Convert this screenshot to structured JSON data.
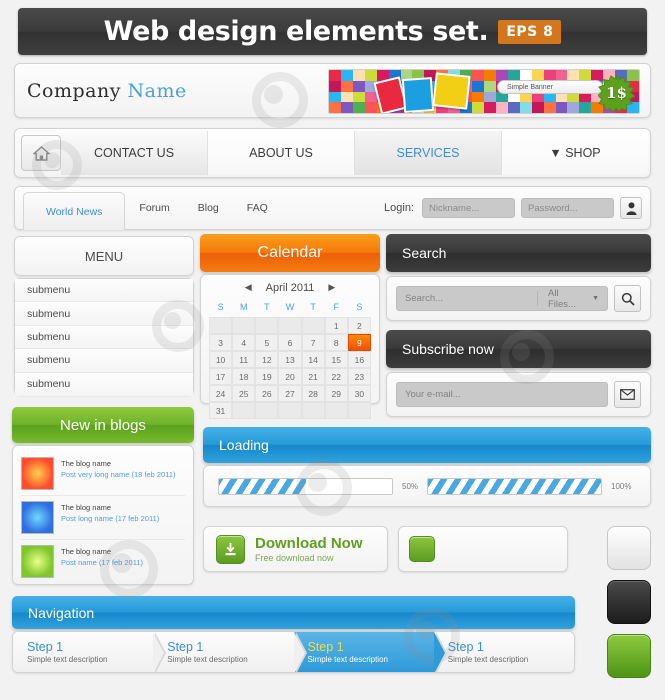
{
  "title_bar": {
    "title": "Web design elements set.",
    "badge": "EPS 8"
  },
  "company": {
    "name_plain": "Company",
    "name_accent": "Name",
    "banner_label": "Simple Banner",
    "price": "1$"
  },
  "main_nav": {
    "home_icon": "home-icon",
    "items": [
      {
        "label": "CONTACT US",
        "selected": false
      },
      {
        "label": "ABOUT US",
        "selected": false
      },
      {
        "label": "SERVICES",
        "selected": true
      },
      {
        "label": "▼ SHOP",
        "selected": false
      }
    ]
  },
  "tab_bar": {
    "tabs": [
      {
        "label": "World News",
        "active": true
      },
      {
        "label": "Forum",
        "active": false
      },
      {
        "label": "Blog",
        "active": false
      },
      {
        "label": "FAQ",
        "active": false
      }
    ],
    "login_label": "Login:",
    "nickname_placeholder": "Nickname...",
    "password_placeholder": "Password...",
    "user_icon": "user-icon"
  },
  "menu": {
    "header": "MENU",
    "items": [
      "submenu",
      "submenu",
      "submenu",
      "submenu",
      "submenu"
    ]
  },
  "calendar": {
    "header": "Calendar",
    "prev_icon": "chevron-left-icon",
    "next_icon": "chevron-right-icon",
    "month": "April 2011",
    "day_names": [
      "S",
      "M",
      "T",
      "W",
      "T",
      "F",
      "S"
    ],
    "leading_blanks": 5,
    "days": [
      1,
      2,
      3,
      4,
      5,
      6,
      7,
      8,
      9,
      10,
      11,
      12,
      13,
      14,
      15,
      16,
      17,
      18,
      19,
      20,
      21,
      22,
      23,
      24,
      25,
      26,
      27,
      28,
      29,
      30,
      31
    ],
    "today": 9
  },
  "search": {
    "header": "Search",
    "placeholder": "Search...",
    "filter": "All Files...",
    "search_icon": "search-icon"
  },
  "subscribe": {
    "header": "Subscribe now",
    "placeholder": "Your e-mail...",
    "mail_icon": "envelope-icon"
  },
  "blogs": {
    "header": "New in blogs",
    "posts": [
      {
        "title": "The blog name",
        "meta": "Post very long name (18 feb 2011)"
      },
      {
        "title": "The blog name",
        "meta": "Post long name (17 feb 2011)"
      },
      {
        "title": "The blog name",
        "meta": "Post name (17 feb 2011)"
      }
    ]
  },
  "loading": {
    "header": "Loading",
    "bars": [
      {
        "percent": 50,
        "label": "50%"
      },
      {
        "percent": 100,
        "label": "100%"
      }
    ]
  },
  "download": {
    "icon": "download-icon",
    "main": "Download Now",
    "sub": "Free download now"
  },
  "navigation": {
    "header": "Navigation",
    "steps": [
      {
        "title": "Step 1",
        "desc": "Simple text description",
        "active": false
      },
      {
        "title": "Step 1",
        "desc": "Simple text description",
        "active": false
      },
      {
        "title": "Step 1",
        "desc": "Simple text description",
        "active": true
      },
      {
        "title": "Step 1",
        "desc": "Simple text description",
        "active": false
      }
    ]
  },
  "square_buttons": [
    {
      "name": "white-square-button"
    },
    {
      "name": "black-square-button"
    },
    {
      "name": "green-square-button"
    }
  ],
  "colors": {
    "accent_blue": "#3c8fd6",
    "orange": "#f57a0c",
    "green": "#6fb32a",
    "dark": "#3a3a3a",
    "badge_orange": "#d4761c"
  }
}
